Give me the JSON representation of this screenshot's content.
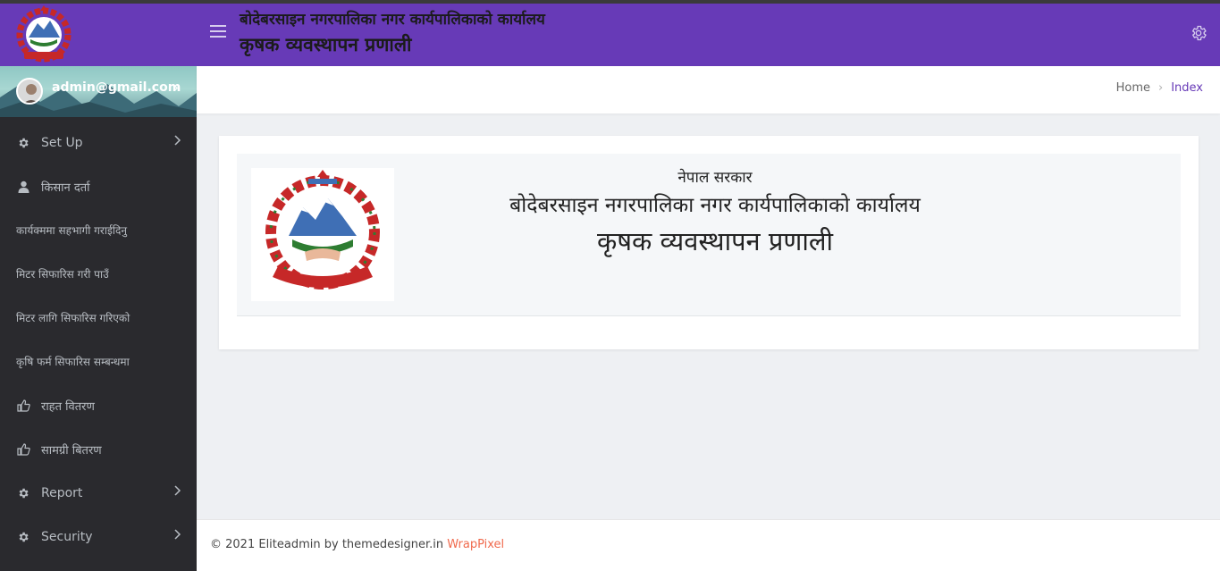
{
  "header": {
    "title_line1": "बोदेबरसाइन नगरपालिका नगर कार्यपालिकाको कार्यालय",
    "title_line2": "कृषक व्यवस्थापन प्रणाली"
  },
  "user": {
    "email": "admin@gmail.com"
  },
  "sidebar": {
    "items": [
      {
        "label": "Set Up",
        "icon": "gear-icon",
        "has_submenu": true
      },
      {
        "label": "किसान दर्ता",
        "icon": "user-icon",
        "has_submenu": false
      },
      {
        "label": "कार्यक्ममा सहभागी गराईदिनु",
        "icon": "",
        "has_submenu": false
      },
      {
        "label": "मिटर सिफारिस गरी पाउँ",
        "icon": "",
        "has_submenu": false
      },
      {
        "label": "मिटर लागि सिफारिस गरिएको",
        "icon": "",
        "has_submenu": false
      },
      {
        "label": "कृषि फर्म सिफारिस सम्बन्धमा",
        "icon": "",
        "has_submenu": false
      },
      {
        "label": "राहत वितरण",
        "icon": "thumbs-up-icon",
        "has_submenu": false
      },
      {
        "label": "सामग्री बितरण",
        "icon": "thumbs-up-icon",
        "has_submenu": false
      },
      {
        "label": "Report",
        "icon": "gear-icon",
        "has_submenu": true
      },
      {
        "label": "Security",
        "icon": "gear-icon",
        "has_submenu": true
      }
    ]
  },
  "breadcrumb": {
    "home": "Home",
    "current": "Index"
  },
  "main": {
    "line1": "नेपाल सरकार",
    "line2": "बोदेबरसाइन नगरपालिका नगर कार्यपालिकाको कार्यालय",
    "line3": "कृषक व्यवस्थापन प्रणाली"
  },
  "footer": {
    "text": "© 2021 Eliteadmin by themedesigner.in",
    "link": "WrapPixel"
  },
  "colors": {
    "brand": "#673ab7",
    "sidebar_bg": "#2a2a2e",
    "footer_link": "#f06a4d"
  }
}
